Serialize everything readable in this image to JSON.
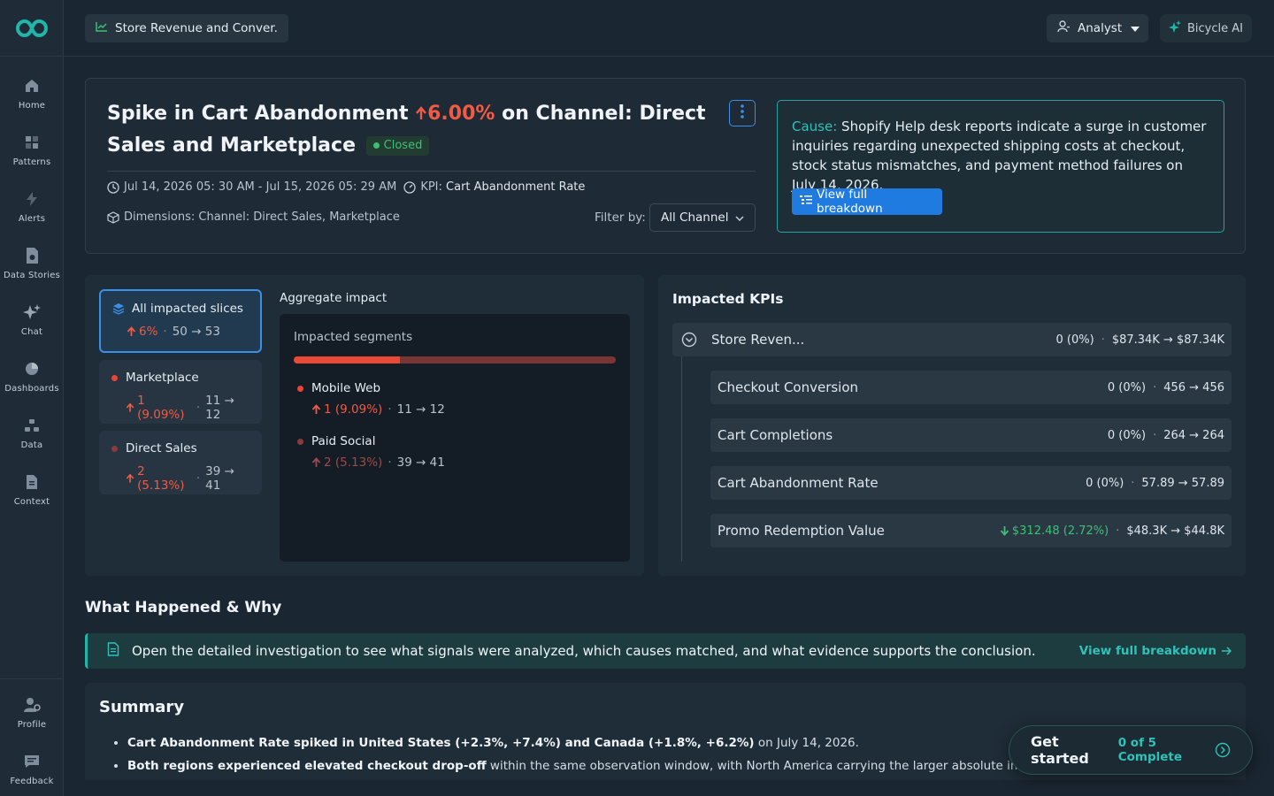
{
  "sidebar": {
    "logo": "bicycle-logo",
    "items": [
      {
        "label": "Home",
        "icon": "home-icon"
      },
      {
        "label": "Patterns",
        "icon": "patterns-icon"
      },
      {
        "label": "Alerts",
        "icon": "lightning-icon"
      },
      {
        "label": "Data Stories",
        "icon": "data-stories-icon"
      },
      {
        "label": "Chat",
        "icon": "sparkle-icon"
      },
      {
        "label": "Dashboards",
        "icon": "pie-chart-icon"
      },
      {
        "label": "Data",
        "icon": "data-icon"
      },
      {
        "label": "Context",
        "icon": "document-icon"
      }
    ],
    "bottom": [
      {
        "label": "Profile",
        "icon": "profile-icon"
      },
      {
        "label": "Feedback",
        "icon": "feedback-icon"
      }
    ]
  },
  "topbar": {
    "breadcrumb": "Store Revenue and Conver...",
    "role": "Analyst",
    "ai_button": "Bicycle AI"
  },
  "header": {
    "title_part1": "Spike in Cart Abandonment ",
    "title_change": "6.00%",
    "title_part2": " on Channel: Direct Sales and Marketplace",
    "status": "Closed",
    "time_range": "Jul 14, 2026 05: 30 AM - Jul 15, 2026 05: 29 AM",
    "kpi_label": "KPI:",
    "kpi_value": "Cart Abandonment Rate",
    "dimensions": "Dimensions: Channel: Direct Sales, Marketplace",
    "filter_label": "Filter by:",
    "filter_value": "All Channel",
    "cause_label": "Cause:",
    "cause_text": " Shopify Help desk reports indicate a surge in customer inquiries regarding unexpected shipping costs at checkout, stock status mismatches, and payment method failures on July 14, 2026.",
    "breakdown_button": "View full breakdown"
  },
  "slices": [
    {
      "name": "All impacted slices",
      "change": "6%",
      "values": "50 → 53",
      "active": true
    },
    {
      "name": "Marketplace",
      "change": "1 (9.09%)",
      "values": "11 → 12",
      "dot": "#e8453a"
    },
    {
      "name": "Direct Sales",
      "change": "2 (5.13%)",
      "values": "39 → 41",
      "dot": "#8a3c3c"
    }
  ],
  "aggregate": {
    "label": "Aggregate impact",
    "heading": "Impacted segments",
    "share": 0.33,
    "segments": [
      {
        "name": "Mobile Web",
        "change": "1 (9.09%)",
        "values": "11 → 12",
        "color": "#e8453a"
      },
      {
        "name": "Paid Social",
        "change": "2 (5.13%)",
        "values": "39 → 41",
        "color": "#8a3c3c"
      }
    ]
  },
  "kpis": {
    "heading": "Impacted KPIs",
    "parent": {
      "name": "Store Reven...",
      "change": "0 (0%)",
      "values": "$87.34K → $87.34K"
    },
    "children": [
      {
        "name": "Checkout Conversion",
        "change": "0 (0%)",
        "values": "456 → 456"
      },
      {
        "name": "Cart Completions",
        "change": "0 (0%)",
        "values": "264 → 264"
      },
      {
        "name": "Cart Abandonment Rate",
        "change": "0 (0%)",
        "values": "57.89 → 57.89"
      },
      {
        "name": "Promo Redemption Value",
        "change": "$312.48 (2.72%)",
        "values": "$48.3K → $44.8K",
        "down": true
      }
    ]
  },
  "what_happened": {
    "heading": "What Happened & Why",
    "banner": "Open the detailed investigation to see what signals were analyzed, which causes matched, and what evidence supports the conclusion.",
    "link": "View full breakdown"
  },
  "summary": {
    "heading": "Summary",
    "b1_bold": "Cart Abandonment Rate spiked in United States (+2.3%, +7.4%) and Canada (+1.8%, +6.2%)",
    "b1_rest": " on July 14, 2026.",
    "b2_bold": "Both regions experienced elevated checkout drop-off",
    "b2_rest": " within the same observation window, with North America carrying the larger absolute impact."
  },
  "get_started": {
    "label": "Get started",
    "progress": "0 of 5 Complete"
  },
  "colors": {
    "accent": "#3a8fe8",
    "teal": "#2fc2b8",
    "red": "#f15a45",
    "green": "#3fbf74"
  }
}
